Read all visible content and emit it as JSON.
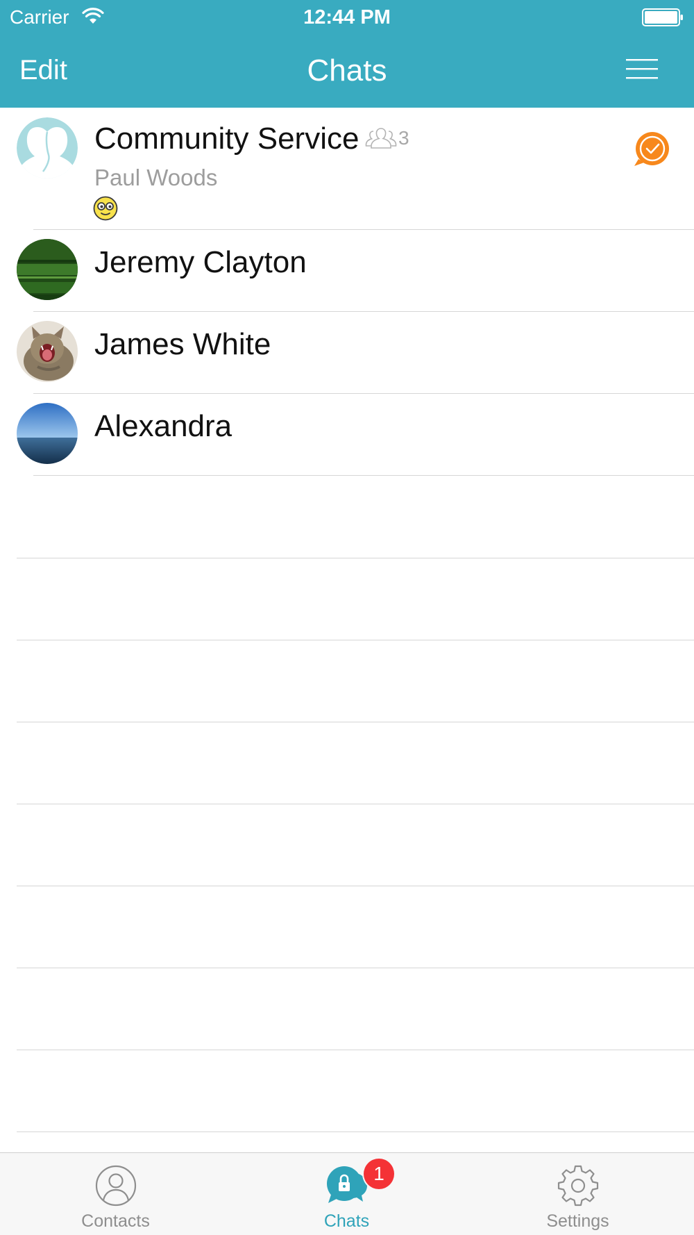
{
  "status_bar": {
    "carrier": "Carrier",
    "time": "12:44 PM"
  },
  "nav": {
    "edit_label": "Edit",
    "title": "Chats",
    "menu_icon": "hamburger-menu-icon"
  },
  "chats": [
    {
      "name": "Community Service",
      "is_group": true,
      "member_count": "3",
      "last_sender": "Paul Woods",
      "last_message_icon": "nerd-face-emoji",
      "status_icon": "orange-checkmark-bubble-icon",
      "avatar": "group-silhouette-avatar"
    },
    {
      "name": "Jeremy Clayton",
      "avatar": "green-book-cover-photo"
    },
    {
      "name": "James White",
      "avatar": "yawning-cat-photo"
    },
    {
      "name": "Alexandra",
      "avatar": "ocean-horizon-photo"
    }
  ],
  "tabs": [
    {
      "label": "Contacts",
      "icon": "person-icon",
      "active": false
    },
    {
      "label": "Chats",
      "icon": "lock-chat-bubble-icon",
      "active": true,
      "badge": "1"
    },
    {
      "label": "Settings",
      "icon": "gear-icon",
      "active": false
    }
  ],
  "colors": {
    "header": "#39abc0",
    "accent": "#2fa3b9",
    "badge": "#f43236",
    "status_check": "#f7881c",
    "separator": "#d6d6d6"
  }
}
